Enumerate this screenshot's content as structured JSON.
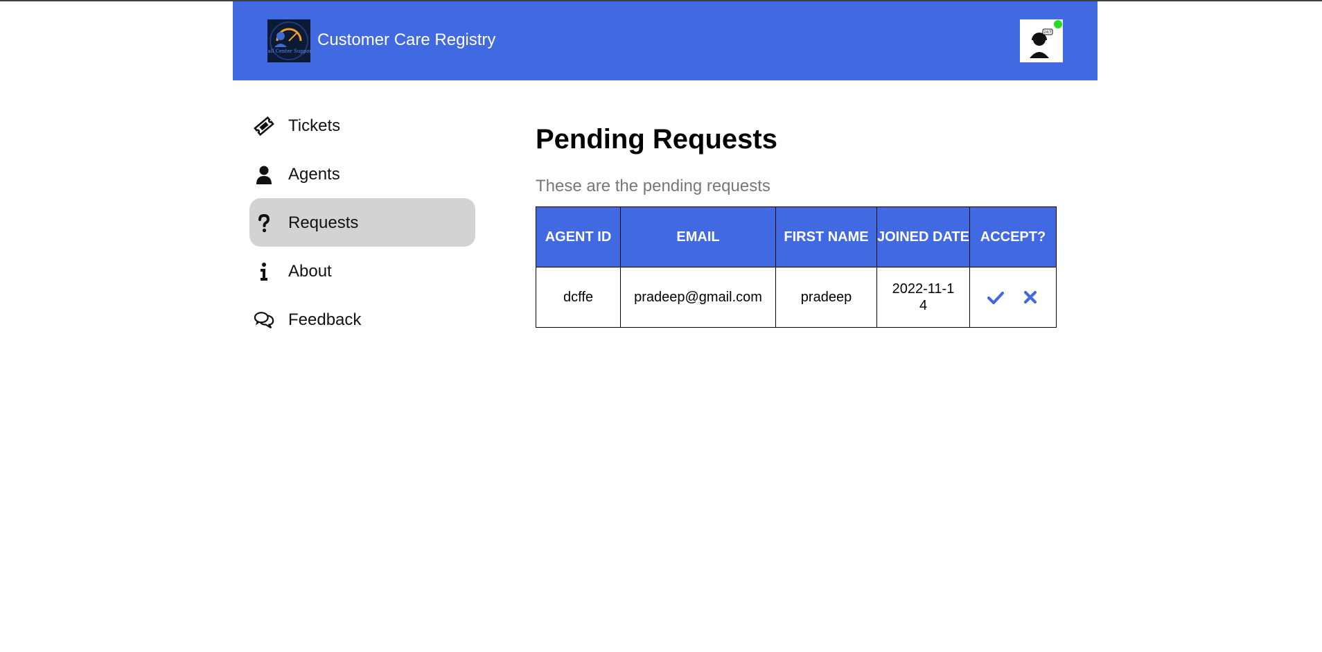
{
  "header": {
    "app_title": "Customer Care Registry",
    "logo_text": "Call Center Support",
    "avatar_bubble_text": "24/7",
    "brand_color": "#4169e1",
    "online_status_color": "#22dd22"
  },
  "sidebar": {
    "items": [
      {
        "label": "Tickets",
        "icon": "ticket-icon",
        "active": false
      },
      {
        "label": "Agents",
        "icon": "user-icon",
        "active": false
      },
      {
        "label": "Requests",
        "icon": "question-icon",
        "active": true
      },
      {
        "label": "About",
        "icon": "info-icon",
        "active": false
      },
      {
        "label": "Feedback",
        "icon": "comments-icon",
        "active": false
      }
    ],
    "active_color": "#d3d3d3"
  },
  "main": {
    "title": "Pending Requests",
    "subtitle": "These are the pending requests",
    "table": {
      "headers": {
        "agent_id": "AGENT ID",
        "email": "EMAIL",
        "first_name": "FIRST NAME",
        "joined_date": "JOINED DATE",
        "accept": "ACCEPT?"
      },
      "rows": [
        {
          "agent_id": "dcffe",
          "email": "pradeep@gmail.com",
          "first_name": "pradeep",
          "joined_date": "2022-11-14",
          "accept_icon": "check-icon",
          "reject_icon": "times-icon"
        }
      ]
    }
  }
}
